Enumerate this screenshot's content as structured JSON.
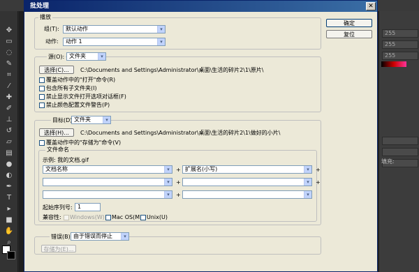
{
  "dialog": {
    "title": "批处理",
    "close_glyph": "✕",
    "ok_label": "确定",
    "reset_label": "复位"
  },
  "play": {
    "legend": "播放",
    "set_label": "组(T):",
    "set_value": "默认动作",
    "action_label": "动作:",
    "action_value": "动作 1"
  },
  "source": {
    "legend_label": "源(O):",
    "source_value": "文件夹",
    "choose_label": "选择(C)...",
    "path": "C:\\Documents and Settings\\Administrator\\桌面\\生活的碎片2\\1\\原片\\",
    "options": [
      "覆盖动作中的\"打开\"命令(R)",
      "包含所有子文件夹(I)",
      "禁止显示文件打开选项对话框(F)",
      "禁止颜色配置文件警告(P)"
    ]
  },
  "destination": {
    "legend_label": "目标(D):",
    "dest_value": "文件夹",
    "choose_label": "选择(H)...",
    "path": "C:\\Documents and Settings\\Administrator\\桌面\\生活的碎片2\\1\\做好的小片\\",
    "override_save": "覆盖动作中的\"存储为\"命令(V)"
  },
  "file_naming": {
    "legend": "文件命名",
    "example": "示例: 我的文档.gif",
    "field1": "文档名称",
    "field2": "扩展名(小写)",
    "plus": "+",
    "serial_label": "起始序列号:",
    "serial_value": "1",
    "compat_label": "兼容性:",
    "windows": "Windows(W)",
    "mac": "Mac OS(M)",
    "unix": "Unix(U)"
  },
  "errors": {
    "label": "错误(B):",
    "value": "由于错误而停止",
    "save_as": "存储为(E)..."
  },
  "ps_panel": {
    "values": [
      "255",
      "255",
      "255"
    ],
    "fill_label": "填充:"
  },
  "icons": {
    "dropdown": "▾"
  }
}
